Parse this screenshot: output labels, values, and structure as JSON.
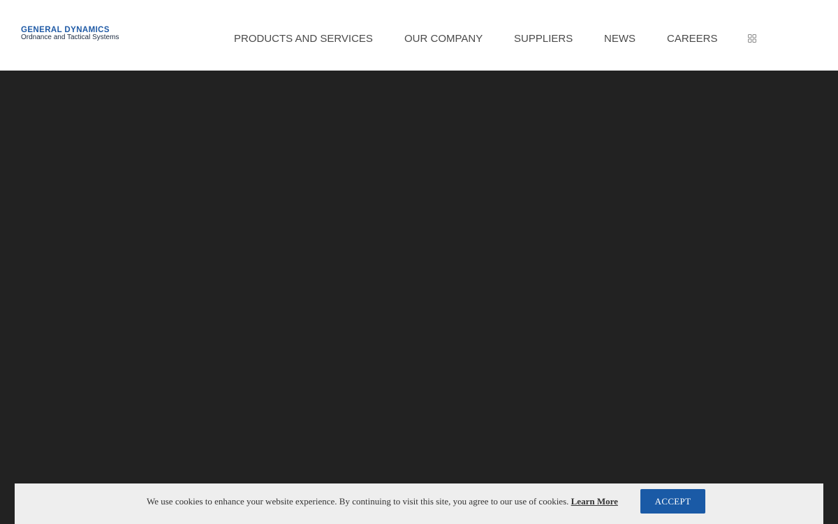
{
  "header": {
    "logo": {
      "line1": "GENERAL DYNAMICS",
      "line2": "Ordnance and Tactical Systems"
    },
    "nav": [
      {
        "label": "PRODUCTS AND SERVICES"
      },
      {
        "label": "OUR COMPANY"
      },
      {
        "label": "SUPPLIERS"
      },
      {
        "label": "NEWS"
      },
      {
        "label": "CAREERS"
      }
    ],
    "grid_icon": "grid-icon"
  },
  "colors": {
    "brand_blue": "#1a5aa6",
    "hero_bg": "#222222",
    "nav_text": "#4a4a4a",
    "cookie_bg": "#eeeeee"
  },
  "cookie_banner": {
    "message": "We use cookies to enhance your website experience. By continuing to visit this site, you agree to our use of cookies.",
    "link_label": "Learn More",
    "accept_label": "ACCEPT"
  }
}
